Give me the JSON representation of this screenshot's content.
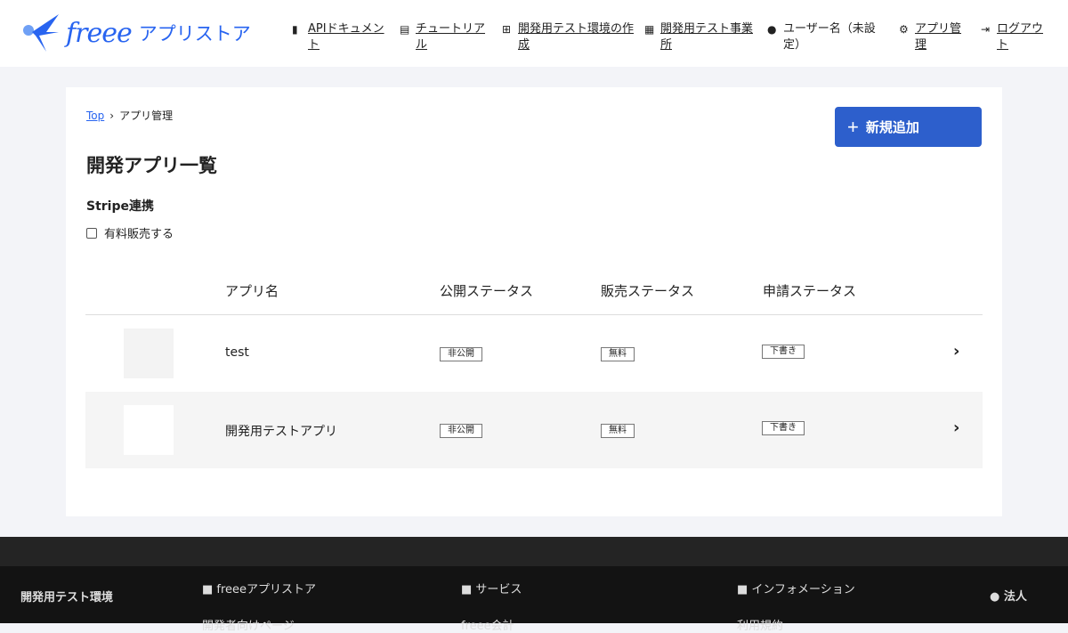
{
  "header": {
    "logo_word": "freee",
    "logo_store": "アプリストア",
    "nav": [
      {
        "icon": "document-icon",
        "line1": "APIドキュメン",
        "line2": "ト"
      },
      {
        "icon": "book-icon",
        "line1": "チュートリア",
        "line2": "ル"
      },
      {
        "icon": "plus-box-icon",
        "line1": "開発用テスト環境の作",
        "line2": "成"
      },
      {
        "icon": "building-icon",
        "line1": "開発用テスト事業",
        "line2": "所"
      },
      {
        "icon": "user-icon",
        "line1": "ユーザー名（未設",
        "line2": "定）"
      },
      {
        "icon": "gear-icon",
        "line1": "アプリ管",
        "line2": "理"
      },
      {
        "icon": "logout-icon",
        "line1": "ログアウ",
        "line2": "ト"
      }
    ]
  },
  "breadcrumb": {
    "top": "Top",
    "sep": "›",
    "current": "アプリ管理"
  },
  "add_button": {
    "icon": "+",
    "label": "新規追加"
  },
  "title": "開発アプリ一覧",
  "stripe": {
    "heading": "Stripe連携",
    "checkbox_label": "有料販売する",
    "checked": false
  },
  "table": {
    "headers": [
      "アプリ名",
      "公開ステータス",
      "販売ステータス",
      "申請ステータス"
    ],
    "rows": [
      {
        "name": "test",
        "public": "非公開",
        "sales": "無料",
        "application": "下書き"
      },
      {
        "name": "開発用テストアプリ",
        "public": "非公開",
        "sales": "無料",
        "application": "下書き"
      }
    ]
  },
  "footer": {
    "env": "開発用テスト環境",
    "col1": "■ freeeアプリストア",
    "col2": "■ サービス",
    "col3": "■ インフォメーション",
    "corp": "法人",
    "link1": "開発者向けページ",
    "link2": "freee会計",
    "link3": "利用規約"
  }
}
